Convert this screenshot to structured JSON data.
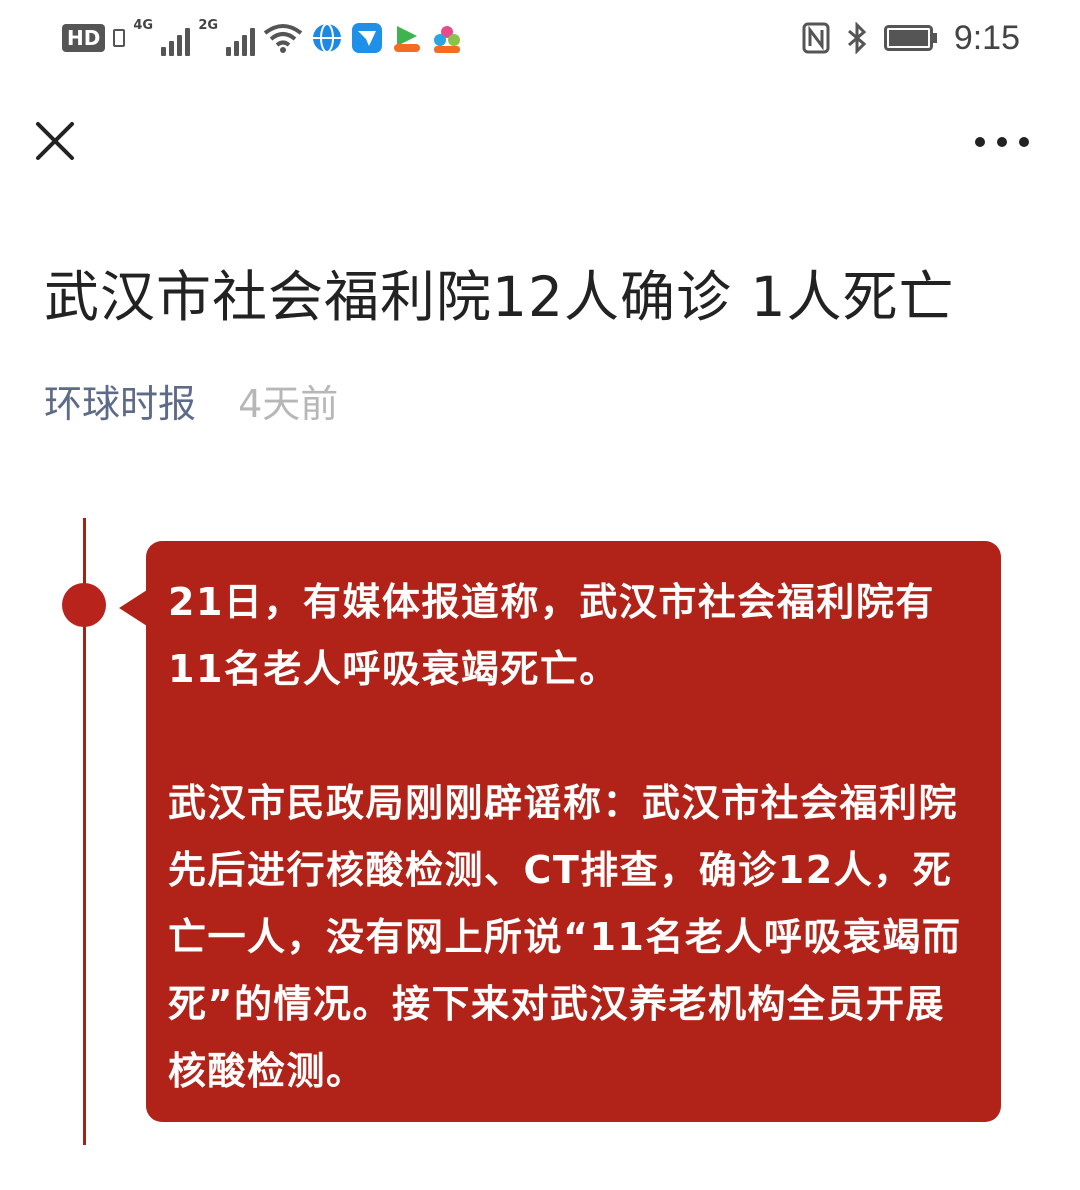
{
  "status_bar": {
    "hd_label": "HD",
    "network1": "4G",
    "network2": "2G",
    "time": "9:15",
    "icons": [
      "hd-icon",
      "sim-icon",
      "signal-4g-icon",
      "signal-2g-icon",
      "wifi-icon",
      "browser-icon",
      "message-icon",
      "video-app-icon",
      "community-app-icon",
      "nfc-icon",
      "bluetooth-icon",
      "battery-icon"
    ]
  },
  "nav": {
    "close_icon": "close-icon",
    "more_icon": "more-icon"
  },
  "article": {
    "title": "武汉市社会福利院12人确诊 1人死亡",
    "source": "环球时报",
    "time": "4天前"
  },
  "card": {
    "paragraphs": [
      "21日，有媒体报道称，武汉市社会福利院有11名老人呼吸衰竭死亡。",
      "武汉市民政局刚刚辟谣称：武汉市社会福利院先后进行核酸检测、CT排查，确诊12人，死亡一人，没有网上所说“11名老人呼吸衰竭而死”的情况。接下来对武汉养老机构全员开展核酸检测。"
    ]
  },
  "colors": {
    "accent": "#b12218",
    "source_text": "#5d6a88",
    "time_text": "#b7b7b7"
  }
}
